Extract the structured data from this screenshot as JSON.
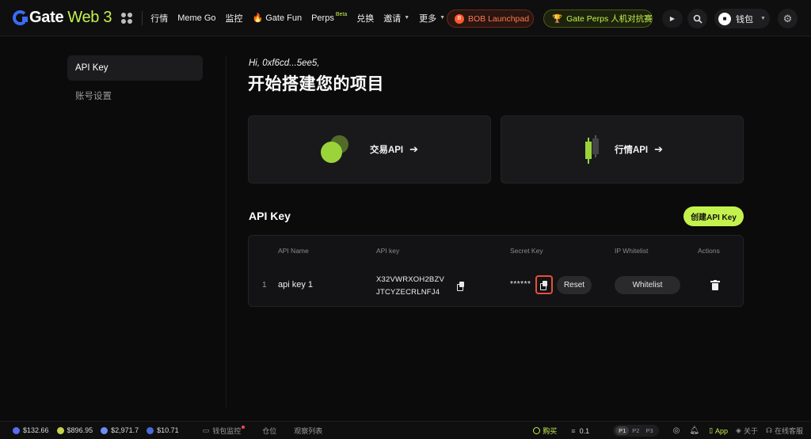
{
  "header": {
    "logo_brand": "Gate",
    "logo_suffix": "Web 3",
    "nav": [
      {
        "label": "行情"
      },
      {
        "label": "Meme Go"
      },
      {
        "label": "监控"
      },
      {
        "label": "Gate Fun"
      },
      {
        "label": "Perps",
        "badge": "Beta"
      },
      {
        "label": "兑换"
      },
      {
        "label": "邀请"
      },
      {
        "label": "更多"
      }
    ],
    "bob_label": "BOB Launchpad",
    "bob_icon_text": "B",
    "perps_promo_label": "Gate Perps 人机对抗赛",
    "wallet_label": "钱包"
  },
  "sidebar": {
    "items": [
      {
        "label": "API Key",
        "active": true
      },
      {
        "label": "账号设置",
        "active": false
      }
    ]
  },
  "main": {
    "greeting": "Hi, 0xf6cd...5ee5,",
    "title": "开始搭建您的项目",
    "cards": [
      {
        "label": "交易API",
        "arrow": "➔"
      },
      {
        "label": "行情API",
        "arrow": "➔"
      }
    ],
    "section_title": "API Key",
    "create_button": "创建API Key",
    "table": {
      "headers": [
        "API Name",
        "API key",
        "Secret Key",
        "IP Whitelist",
        "Actions"
      ],
      "rows": [
        {
          "index": "1",
          "name": "api key 1",
          "key_line1": "X32VWRXOH2BZV",
          "key_line2": "JTCYZECRLNFJ4",
          "secret": "******",
          "reset_label": "Reset",
          "whitelist_label": "Whitelist"
        }
      ]
    }
  },
  "footer": {
    "tickers": [
      {
        "value": "$132.66",
        "color": "#5b6cf0"
      },
      {
        "value": "$896.95",
        "color": "#c4d24d"
      },
      {
        "value": "$2,971.7",
        "color": "#6d8cf5"
      },
      {
        "value": "$10.71",
        "color": "#4a6ad8"
      }
    ],
    "links": [
      {
        "label": "钱包监控"
      },
      {
        "label": "仓位"
      },
      {
        "label": "观察列表"
      }
    ],
    "buy_label": "购买",
    "amount": "0.1",
    "presets": [
      "P1",
      "P2",
      "P3"
    ],
    "app_label": "App",
    "about_label": "关于",
    "support_label": "在线客服"
  }
}
